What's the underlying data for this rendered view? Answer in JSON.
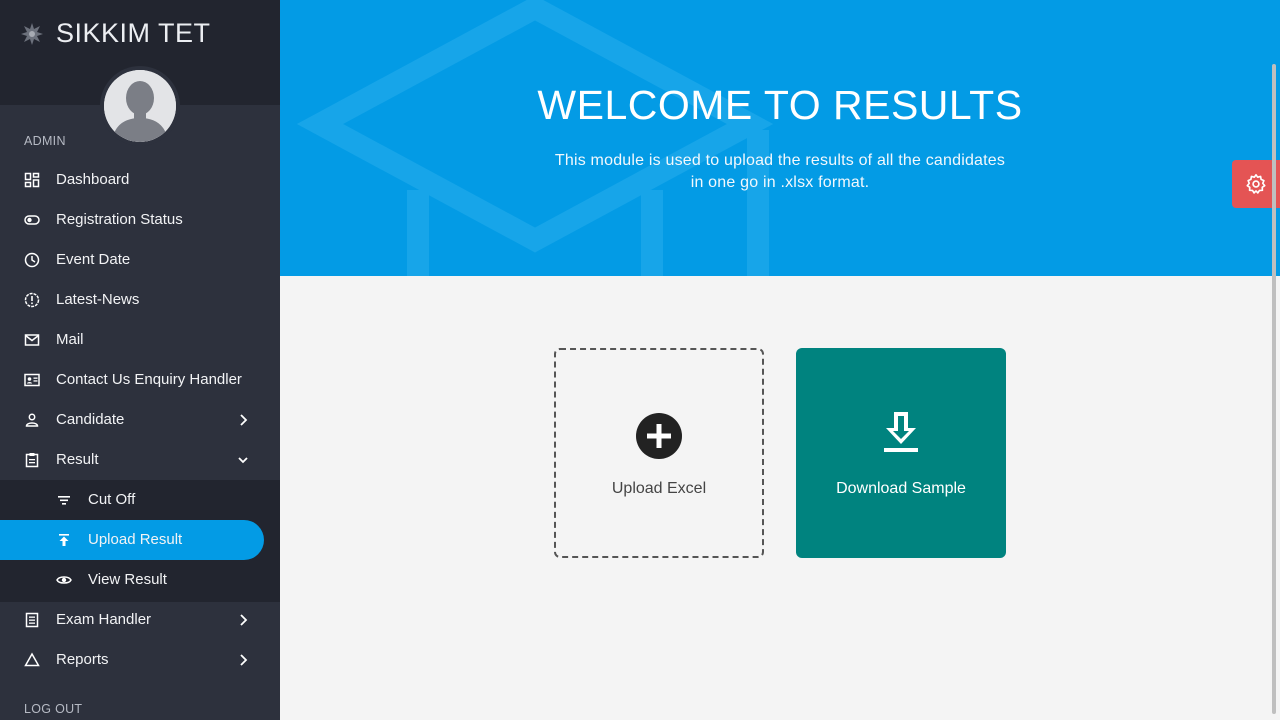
{
  "brand": {
    "name": "SIKKIM TET"
  },
  "sidebar": {
    "section_admin": "ADMIN",
    "items": [
      {
        "label": "Dashboard",
        "icon": "dashboard-icon"
      },
      {
        "label": "Registration Status",
        "icon": "toggle-icon"
      },
      {
        "label": "Event Date",
        "icon": "clock-icon"
      },
      {
        "label": "Latest-News",
        "icon": "alert-icon"
      },
      {
        "label": "Mail",
        "icon": "mail-icon"
      },
      {
        "label": "Contact Us Enquiry Handler",
        "icon": "contact-card-icon"
      },
      {
        "label": "Candidate",
        "icon": "user-icon",
        "has_children": true
      },
      {
        "label": "Result",
        "icon": "clipboard-icon",
        "expanded": true
      },
      {
        "label": "Exam Handler",
        "icon": "list-icon",
        "has_children": true
      },
      {
        "label": "Reports",
        "icon": "triangle-icon",
        "has_children": true
      }
    ],
    "result_children": [
      {
        "label": "Cut Off",
        "icon": "filter-icon"
      },
      {
        "label": "Upload Result",
        "icon": "upload-icon",
        "active": true
      },
      {
        "label": "View Result",
        "icon": "eye-icon"
      }
    ],
    "logout": "LOG OUT"
  },
  "hero": {
    "title": "WELCOME TO RESULTS",
    "description_line1": "This module is used to upload the results of all the candidates",
    "description_line2": "in one go in .xlsx format."
  },
  "actions": {
    "upload_label": "Upload Excel",
    "download_label": "Download Sample"
  },
  "colors": {
    "sidebar_bg": "#2d313d",
    "sidebar_header_bg": "#22252f",
    "accent": "#039be5",
    "download_card": "#00837f",
    "settings_tab": "#e45454"
  }
}
